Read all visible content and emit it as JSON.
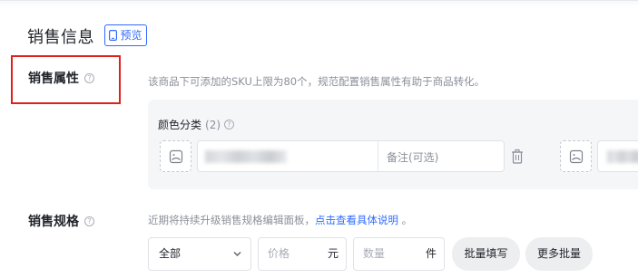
{
  "header": {
    "title": "销售信息",
    "preview_label": "预览"
  },
  "sales_attr": {
    "label": "销售属性",
    "hint": "该商品下可添加的SKU上限为80个，规范配置销售属性有助于商品转化。",
    "color_group": {
      "label": "颜色分类",
      "count": "(2)",
      "note_placeholder": "备注(可选)"
    }
  },
  "sales_spec": {
    "label": "销售规格",
    "hint_text": "近期将持续升级销售规格编辑面板，",
    "hint_link": "点击查看具体说明",
    "hint_tail": "。",
    "select_value": "全部",
    "price_placeholder": "价格",
    "price_unit": "元",
    "qty_placeholder": "数量",
    "qty_unit": "件",
    "batch_fill_label": "批量填写",
    "more_batch_label": "更多批量"
  },
  "colors": {
    "accent": "#2f6bff",
    "highlight_box": "#e0201b",
    "panel_bg": "#f5f6f8"
  }
}
